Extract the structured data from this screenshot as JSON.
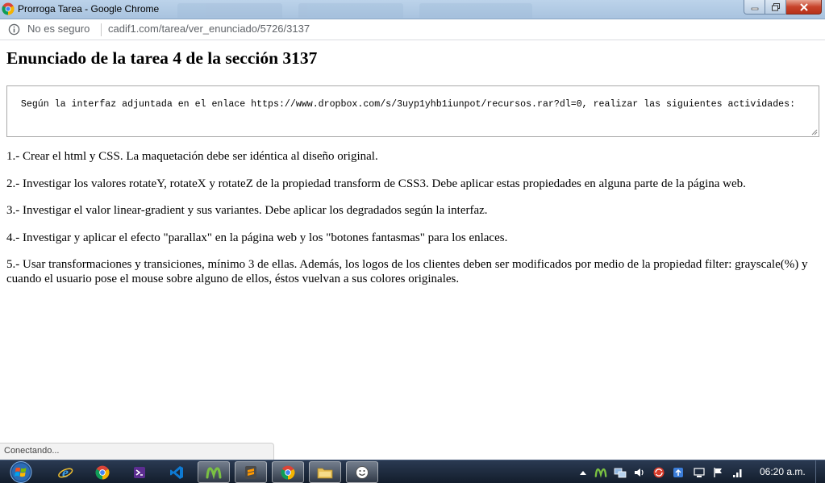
{
  "window": {
    "title": "Prorroga Tarea - Google Chrome"
  },
  "addressbar": {
    "security_label": "No es seguro",
    "url": "cadif1.com/tarea/ver_enunciado/5726/3137"
  },
  "page": {
    "title": "Enunciado de la tarea 4 de la sección 3137",
    "statement": "Según la interfaz adjuntada en el enlace https://www.dropbox.com/s/3uyp1yhb1iunpot/recursos.rar?dl=0, realizar las siguientes actividades:",
    "items": [
      "1.- Crear el html y CSS. La maquetación debe ser idéntica al diseño original.",
      "2.- Investigar los valores rotateY, rotateX y rotateZ de la propiedad transform de CSS3. Debe aplicar estas propiedades en alguna parte de la página web.",
      "3.- Investigar el valor linear-gradient y sus variantes. Debe aplicar los degradados según la interfaz.",
      "4.- Investigar y aplicar el efecto \"parallax\" en la página web y los \"botones fantasmas\" para los enlaces.",
      "5.- Usar transformaciones y transiciones, mínimo 3 de ellas. Además, los logos de los clientes deben ser modificados por medio de la propiedad filter: grayscale(%) y cuando el usuario pose el mouse sobre alguno de ellos, éstos vuelvan a sus colores originales."
    ]
  },
  "status": {
    "text": "Conectando..."
  },
  "taskbar": {
    "clock": "06:20 a.m.",
    "icons": [
      "start-orb-icon",
      "internet-explorer-icon",
      "chrome-icon",
      "visual-studio-icon",
      "vscode-icon",
      "movistar-icon",
      "sublime-text-icon",
      "chrome-icon",
      "file-explorer-icon",
      "smiley-app-icon"
    ],
    "tray_icons": [
      "show-hidden-icons-icon",
      "movistar-tray-icon",
      "network-tray-icon",
      "volume-icon",
      "sync-icon",
      "update-icon",
      "notification-icon",
      "flag-icon",
      "network-icon"
    ]
  },
  "colors": {
    "taskbar_bg": "#1b2637",
    "titlebar_bg": "#bcd3ea",
    "close_button": "#c7432b",
    "text": "#000000"
  }
}
